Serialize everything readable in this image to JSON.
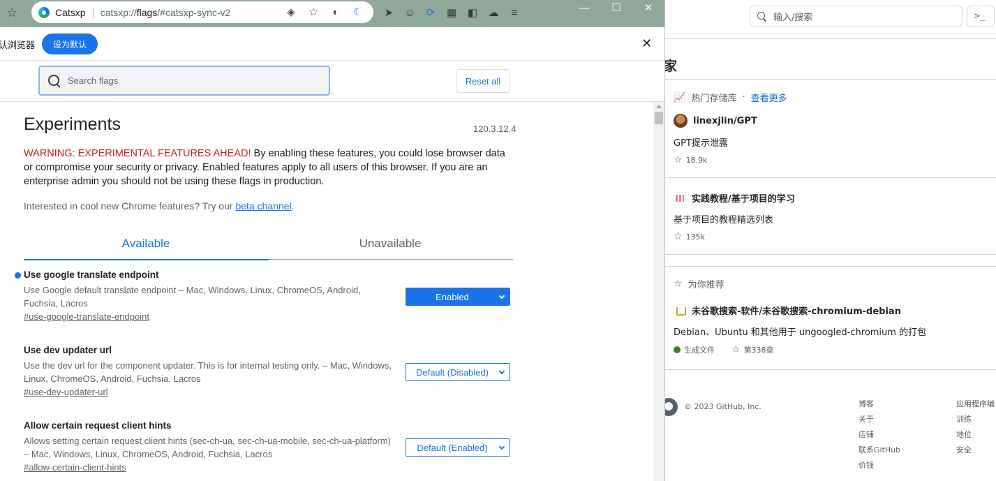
{
  "browser": {
    "brand": "Catsxp",
    "url_prefix": "catsxp://",
    "url_host": "flags",
    "url_rest": "/#catsxp-sync-v2",
    "infobar_text": "认浏览器",
    "set_default_label": "设为默认",
    "close_symbol": "✕"
  },
  "flags_page": {
    "search_placeholder": "Search flags",
    "reset_label": "Reset all",
    "title": "Experiments",
    "version": "120.3.12.4",
    "warning_label": "WARNING: EXPERIMENTAL FEATURES AHEAD!",
    "warning_text": " By enabling these features, you could lose browser data or compromise your security or privacy. Enabled features apply to all users of this browser. If you are an enterprise admin you should not be using these flags in production.",
    "interest_text": "Interested in cool new Chrome features? Try our ",
    "interest_link": "beta channel",
    "interest_end": ".",
    "tabs": [
      "Available",
      "Unavailable"
    ],
    "flags": [
      {
        "name": "Use google translate endpoint",
        "desc": "Use Google default translate endpoint – Mac, Windows, Linux, ChromeOS, Android, Fuchsia, Lacros",
        "link": "#use-google-translate-endpoint",
        "value": "Enabled"
      },
      {
        "name": "Use dev updater url",
        "desc": "Use the dev url for the component updater. This is for internal testing only. – Mac, Windows, Linux, ChromeOS, Android, Fuchsia, Lacros",
        "link": "#use-dev-updater-url",
        "value": "Default (Disabled)"
      },
      {
        "name": "Allow certain request client hints",
        "desc": "Allows setting certain request client hints (sec-ch-ua, sec-ch-ua-mobile, sec-ch-ua-platform) – Mac, Windows, Linux, ChromeOS, Android, Fuchsia, Lacros",
        "link": "#allow-certain-client-hints",
        "value": "Default (Enabled)"
      }
    ]
  },
  "github": {
    "search_placeholder": "输入/搜索",
    "cmd_symbol": ">_",
    "home_title": "家",
    "trending_label": "热门存储库",
    "trending_dot": "·",
    "see_more": "查看更多",
    "repos": [
      {
        "name": "linexjlin/GPT",
        "desc": "GPT提示泄露",
        "stars": "18.9k"
      },
      {
        "name": "实践教程/基于项目的学习",
        "desc": "基于项目的教程精选列表",
        "stars": "135k"
      }
    ],
    "for_you_label": "为你推荐",
    "rec_repo": {
      "name": "未谷歌搜索-软件/未谷歌搜索-chromium-debian",
      "desc": "Debian、Ubuntu 和其他用于 ungoogled-chromium 的打包",
      "lang": "生成文件",
      "rank": "第338章"
    },
    "copyright": "© 2023 GitHub, Inc.",
    "footer_col1": [
      "博客",
      "关于",
      "店铺",
      "联系GitHub",
      "价钱"
    ],
    "footer_col2": [
      "应用程序编",
      "训练",
      "地位",
      "安全"
    ]
  }
}
